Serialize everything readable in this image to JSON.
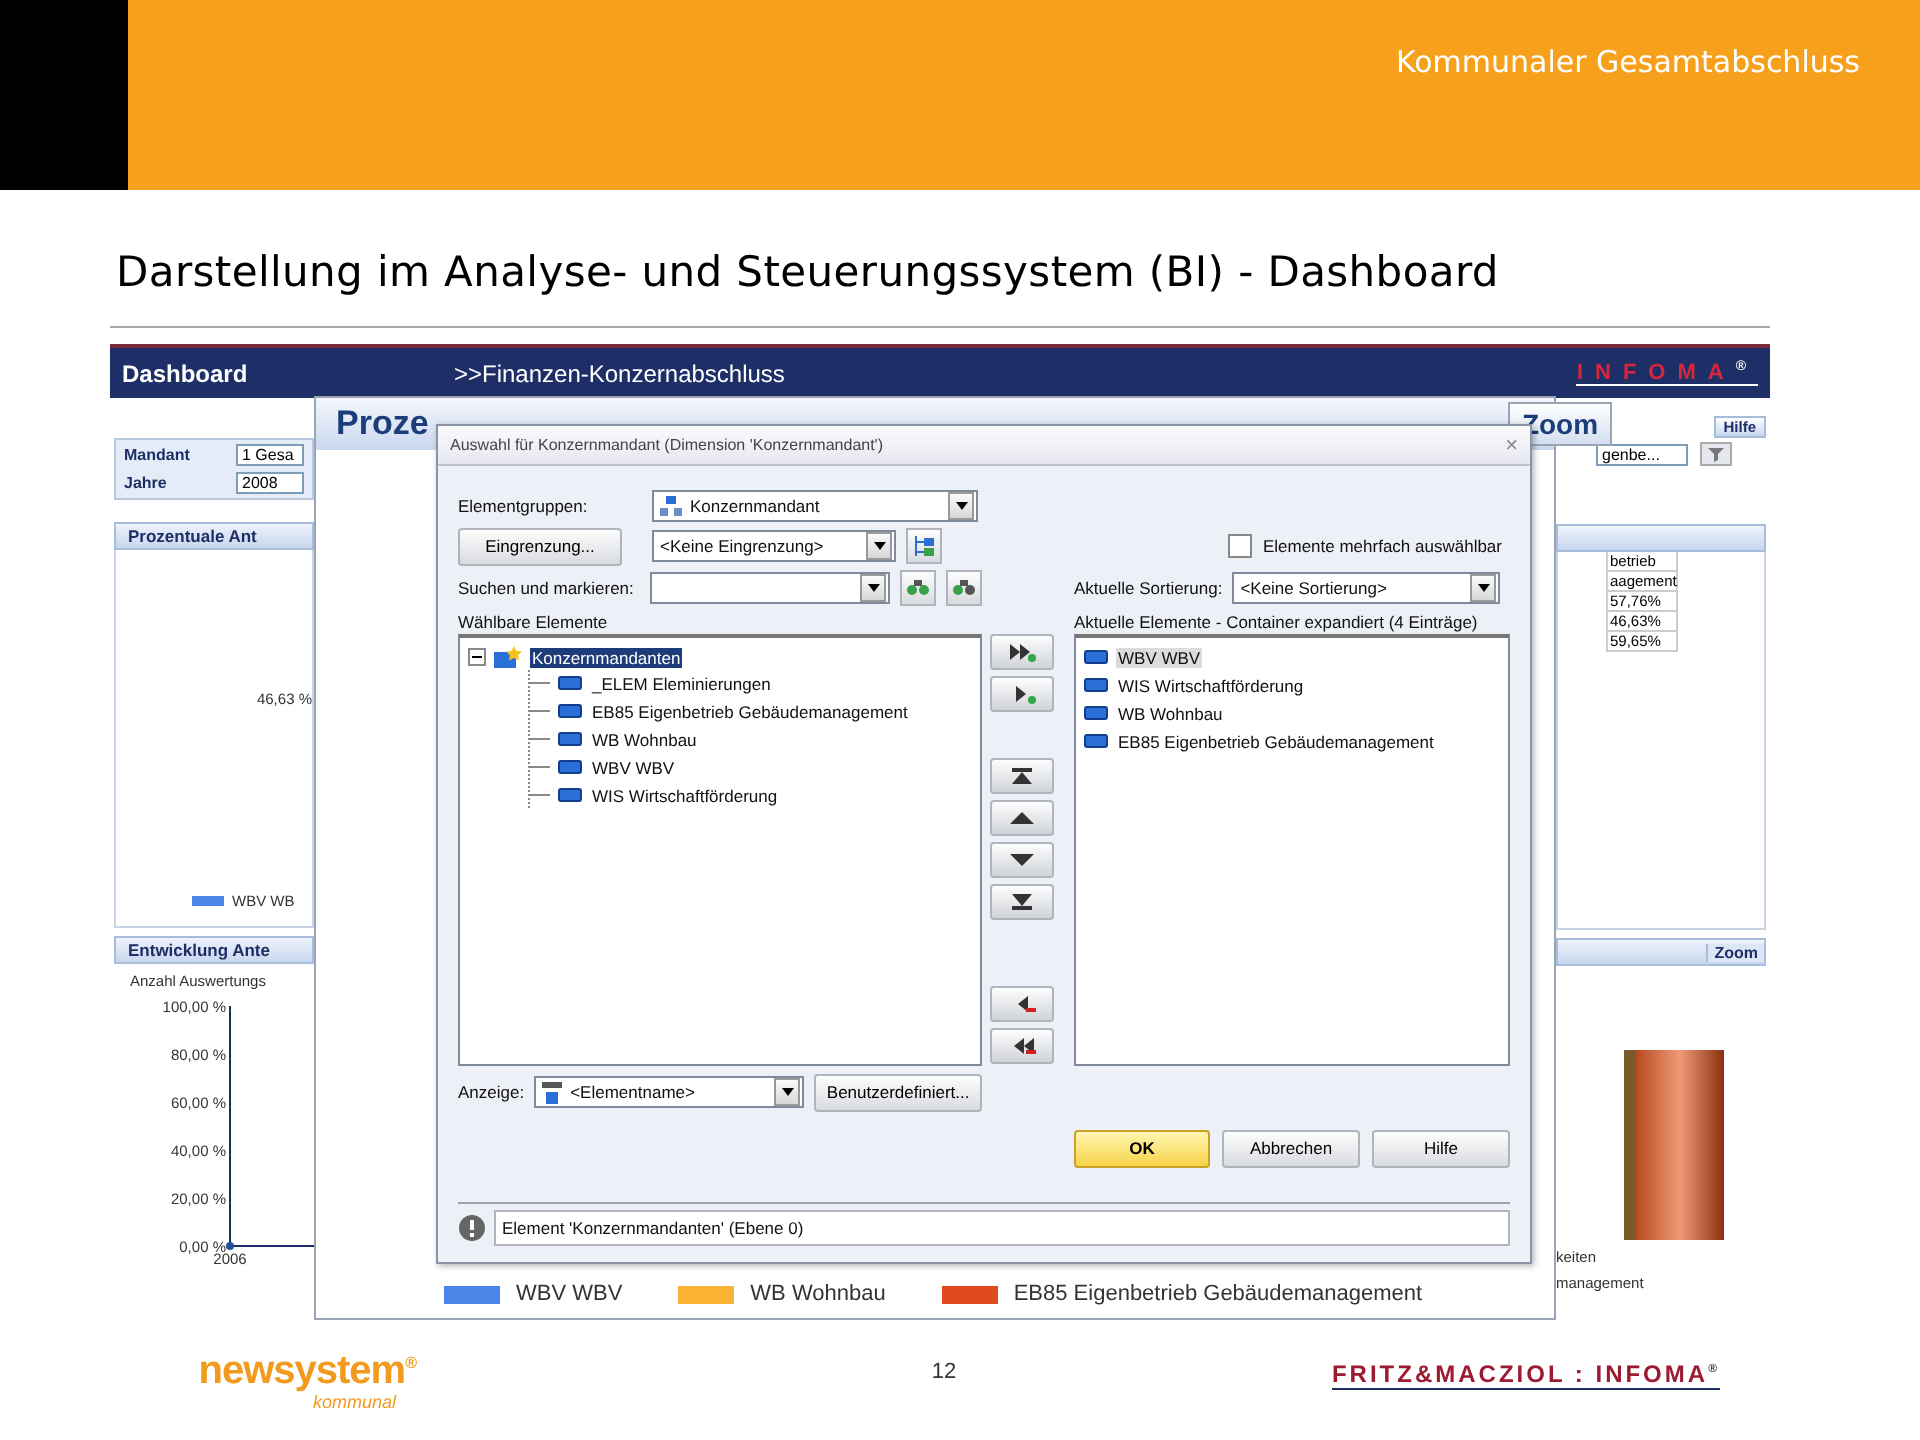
{
  "header": {
    "title": "Kommunaler Gesamtabschluss"
  },
  "slide_title": "Darstellung im Analyse- und Steuerungssystem (BI) - Dashboard",
  "dashboard": {
    "title": "Dashboard",
    "breadcrumb": ">>Finanzen-Konzernabschluss",
    "brand": "INFOMA",
    "brand_mark": "®",
    "filters": [
      {
        "label": "Mandant",
        "value": "1 Gesa"
      },
      {
        "label": "Jahre",
        "value": "2008"
      }
    ],
    "help_button": "Hilfe",
    "right_field": "genbe...",
    "panel_1": {
      "title": "Prozentuale Ant",
      "value_label": "46,63 %",
      "legend": "WBV WB",
      "table_rows": [
        "betrieb",
        "aagement",
        "57,76%",
        "46,63%",
        "59,65%"
      ]
    },
    "panel_2": {
      "title": "Entwicklung Ante",
      "zoom": "Zoom",
      "subtitle": "Anzahl Auswertungs",
      "chart_data": {
        "type": "line",
        "categories": [
          "2006"
        ],
        "series": [
          {
            "values": [
              0
            ],
            "marker": true
          }
        ],
        "ylim": [
          0,
          100
        ],
        "yticks": [
          {
            "value": 0,
            "label": "0,00 %"
          },
          {
            "value": 20,
            "label": "20,00 %"
          },
          {
            "value": 40,
            "label": "40,00 %"
          },
          {
            "value": 60,
            "label": "60,00 %"
          },
          {
            "value": 80,
            "label": "80,00 %"
          },
          {
            "value": 100,
            "label": "100,00 %"
          }
        ]
      },
      "legend_right": [
        "keiten",
        "management"
      ]
    }
  },
  "popup": {
    "title": "Proze",
    "zoom": "Zoom",
    "legend": [
      {
        "label": "WBV WBV",
        "color": "#4a86e8"
      },
      {
        "label": "WB Wohnbau",
        "color": "#f9b233"
      },
      {
        "label": "EB85 Eigenbetrieb Gebäudemanagement",
        "color": "#e04a1c"
      }
    ]
  },
  "dialog": {
    "title": "Auswahl für Konzernmandant (Dimension 'Konzernmandant')",
    "close": "×",
    "element_groups": {
      "label": "Elementgruppen:",
      "value": "Konzernmandant"
    },
    "restriction": {
      "button": "Eingrenzung...",
      "value": "<Keine Eingrenzung>"
    },
    "search": {
      "label": "Suchen und markieren:"
    },
    "multi_select": {
      "label": "Elemente mehrfach auswählbar",
      "checked": false
    },
    "sorting": {
      "label": "Aktuelle Sortierung:",
      "value": "<Keine Sortierung>"
    },
    "available": {
      "label": "Wählbare Elemente",
      "tree": [
        {
          "label": "Konzernmandanten",
          "selected": true,
          "expanded": true,
          "children": [
            {
              "label": "_ELEM Eleminierungen",
              "selected": false
            },
            {
              "label": "EB85 Eigenbetrieb Gebäudemanagement",
              "selected": false
            },
            {
              "label": "WB Wohnbau",
              "selected": false
            },
            {
              "label": "WBV WBV",
              "selected": false
            },
            {
              "label": "WIS Wirtschaftförderung",
              "selected": false
            }
          ]
        }
      ]
    },
    "current": {
      "label": "Aktuelle Elemente - Container expandiert (4 Einträge)",
      "items": [
        {
          "label": "WBV WBV",
          "selected": true
        },
        {
          "label": "WIS Wirtschaftförderung",
          "selected": false
        },
        {
          "label": "WB Wohnbau",
          "selected": false
        },
        {
          "label": "EB85 Eigenbetrieb Gebäudemanagement",
          "selected": false
        }
      ]
    },
    "display": {
      "label": "Anzeige:",
      "value": "<Elementname>",
      "button": "Benutzerdefiniert..."
    },
    "buttons": [
      {
        "label": "OK",
        "kind": "default"
      },
      {
        "label": "Abbrechen",
        "kind": "normal"
      },
      {
        "label": "Hilfe",
        "kind": "normal"
      }
    ],
    "status": "Element 'Konzernmandanten' (Ebene 0)"
  },
  "footer": {
    "logo": "newsystem",
    "logo_mark": "®",
    "logo_sub": "kommunal",
    "page": "12",
    "partner": "FRITZ&MACZIOL : INFOMA",
    "partner_mark": "®"
  }
}
